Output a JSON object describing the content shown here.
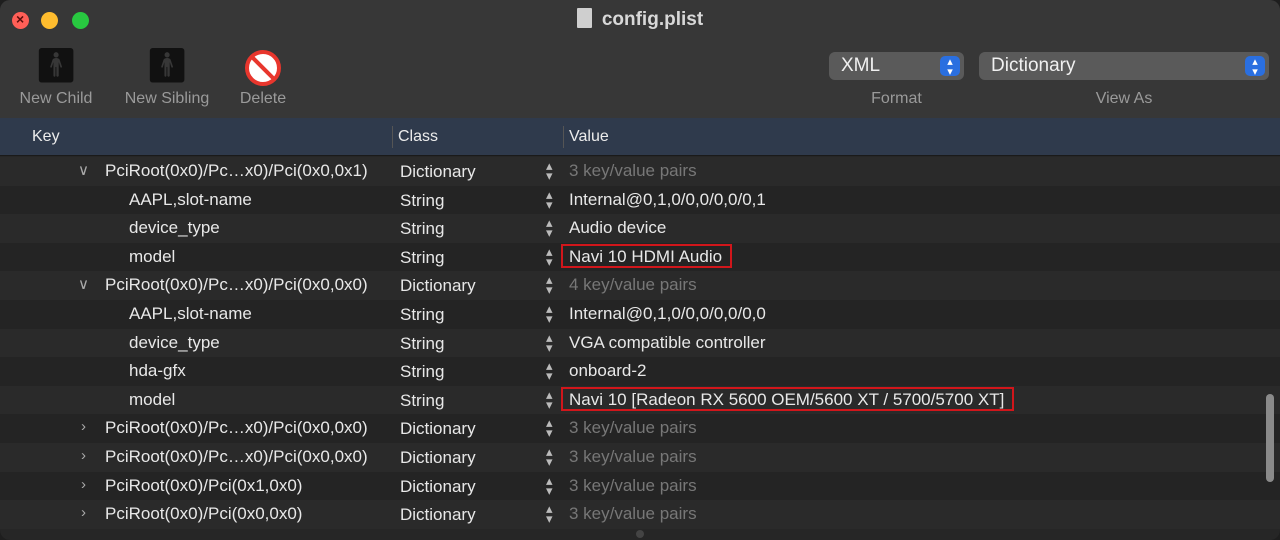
{
  "window": {
    "title": "config.plist"
  },
  "toolbar": {
    "new_child_label": "New Child",
    "new_sibling_label": "New Sibling",
    "delete_label": "Delete",
    "format_value": "XML",
    "format_label": "Format",
    "view_as_value": "Dictionary",
    "view_as_label": "View As"
  },
  "columns": {
    "key": "Key",
    "class": "Class",
    "value": "Value"
  },
  "rows": [
    {
      "key": "PciRoot(0x0)/Pc…x0)/Pci(0x0,0x1)",
      "disclosure": "expanded",
      "class": "Dictionary",
      "value": "3 key/value pairs",
      "dim": true
    },
    {
      "key": "AAPL,slot-name",
      "class": "String",
      "value": "Internal@0,1,0/0,0/0,0/0,1"
    },
    {
      "key": "device_type",
      "class": "String",
      "value": "Audio device"
    },
    {
      "key": "model",
      "class": "String",
      "value": "Navi 10 HDMI Audio",
      "highlighted": true
    },
    {
      "key": "PciRoot(0x0)/Pc…x0)/Pci(0x0,0x0)",
      "disclosure": "expanded",
      "class": "Dictionary",
      "value": "4 key/value pairs",
      "dim": true
    },
    {
      "key": "AAPL,slot-name",
      "class": "String",
      "value": "Internal@0,1,0/0,0/0,0/0,0"
    },
    {
      "key": "device_type",
      "class": "String",
      "value": "VGA compatible controller"
    },
    {
      "key": "hda-gfx",
      "class": "String",
      "value": "onboard-2"
    },
    {
      "key": "model",
      "class": "String",
      "value": "Navi 10 [Radeon RX 5600 OEM/5600 XT / 5700/5700 XT]",
      "highlighted": true
    },
    {
      "key": "PciRoot(0x0)/Pc…x0)/Pci(0x0,0x0)",
      "disclosure": "collapsed",
      "class": "Dictionary",
      "value": "3 key/value pairs",
      "dim": true
    },
    {
      "key": "PciRoot(0x0)/Pc…x0)/Pci(0x0,0x0)",
      "disclosure": "collapsed",
      "class": "Dictionary",
      "value": "3 key/value pairs",
      "dim": true
    },
    {
      "key": "PciRoot(0x0)/Pci(0x1,0x0)",
      "disclosure": "collapsed",
      "class": "Dictionary",
      "value": "3 key/value pairs",
      "dim": true
    },
    {
      "key": "PciRoot(0x0)/Pci(0x0,0x0)",
      "disclosure": "collapsed",
      "class": "Dictionary",
      "value": "3 key/value pairs",
      "dim": true
    }
  ],
  "colors": {
    "highlight_border": "#d1161b",
    "accent": "#2a6fe0"
  }
}
